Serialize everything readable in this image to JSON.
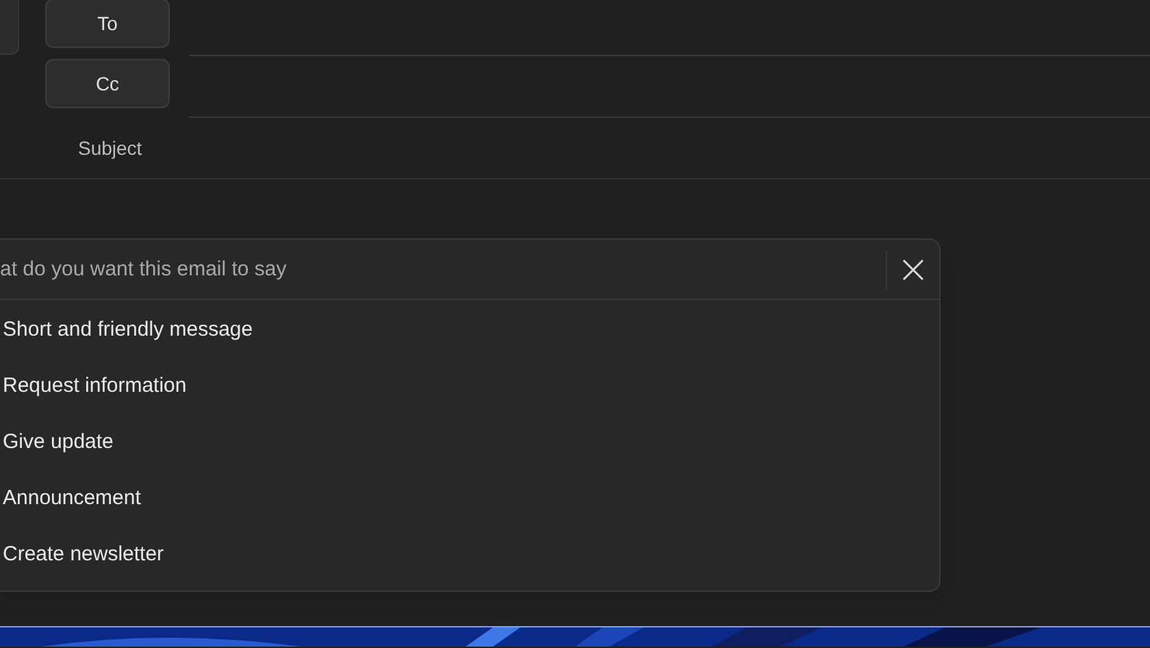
{
  "recipients": [
    {
      "label": "To"
    },
    {
      "label": "Cc"
    }
  ],
  "subject_label": "Subject",
  "prompt_panel": {
    "placeholder": "at do you want this email to say",
    "suggestions": [
      "Short and friendly message",
      "Request information",
      "Give update",
      "Announcement",
      "Create newsletter"
    ]
  }
}
